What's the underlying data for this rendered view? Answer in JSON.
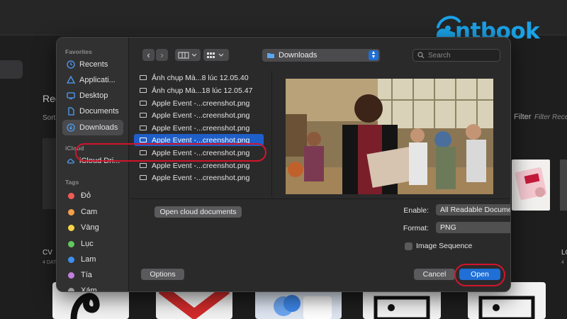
{
  "background": {
    "section_title": "Rec",
    "sort_label": "Sort",
    "filter_label": "Filter",
    "filter_placeholder": "Filter Rece",
    "card_left_title": "CV",
    "card_left_sub": "4 DAT",
    "card_right_title": "LO",
    "card_right_sub": "4"
  },
  "logo": {
    "text": "ntbook",
    "brand_color": "#1aa3e8"
  },
  "sidebar": {
    "favorites_heading": "Favorites",
    "favorites": [
      {
        "label": "Recents",
        "icon": "clock-icon"
      },
      {
        "label": "Applicati...",
        "icon": "applications-icon"
      },
      {
        "label": "Desktop",
        "icon": "desktop-icon"
      },
      {
        "label": "Documents",
        "icon": "document-icon"
      },
      {
        "label": "Downloads",
        "icon": "download-icon",
        "selected": true
      }
    ],
    "icloud_heading": "iCloud",
    "icloud": [
      {
        "label": "iCloud Dri...",
        "icon": "cloud-icon"
      }
    ],
    "tags_heading": "Tags",
    "tags": [
      {
        "label": "Đỏ",
        "color": "#f25c54"
      },
      {
        "label": "Cam",
        "color": "#f5a04a"
      },
      {
        "label": "Vàng",
        "color": "#f5d547"
      },
      {
        "label": "Lục",
        "color": "#5fcc5a"
      },
      {
        "label": "Lam",
        "color": "#3d8ff0"
      },
      {
        "label": "Tía",
        "color": "#c47ee0"
      },
      {
        "label": "Xám",
        "color": "#9a9a9a"
      }
    ]
  },
  "toolbar": {
    "back": "‹",
    "forward": "›",
    "location": "Downloads",
    "search_placeholder": "Search"
  },
  "files": [
    {
      "name": "Ảnh chụp Mà...8 lúc 12.05.40"
    },
    {
      "name": "Ảnh chụp Mà...18 lúc 12.05.47"
    },
    {
      "name": "Apple Event -...creenshot.png"
    },
    {
      "name": "Apple Event -...creenshot.png"
    },
    {
      "name": "Apple Event -...creenshot.png"
    },
    {
      "name": "Apple Event -...creenshot.png",
      "selected": true
    },
    {
      "name": "Apple Event -...creenshot.png"
    },
    {
      "name": "Apple Event -...creenshot.png"
    },
    {
      "name": "Apple Event -...creenshot.png"
    }
  ],
  "options": {
    "cloud_button": "Open cloud documents",
    "enable_label": "Enable:",
    "enable_value": "All Readable Documents",
    "format_label": "Format:",
    "format_value": "PNG",
    "image_sequence_label": "Image Sequence"
  },
  "footer": {
    "options_button": "Options",
    "cancel_button": "Cancel",
    "open_button": "Open"
  },
  "colors": {
    "accent": "#1f6fd6",
    "annotation": "#d2142b"
  }
}
